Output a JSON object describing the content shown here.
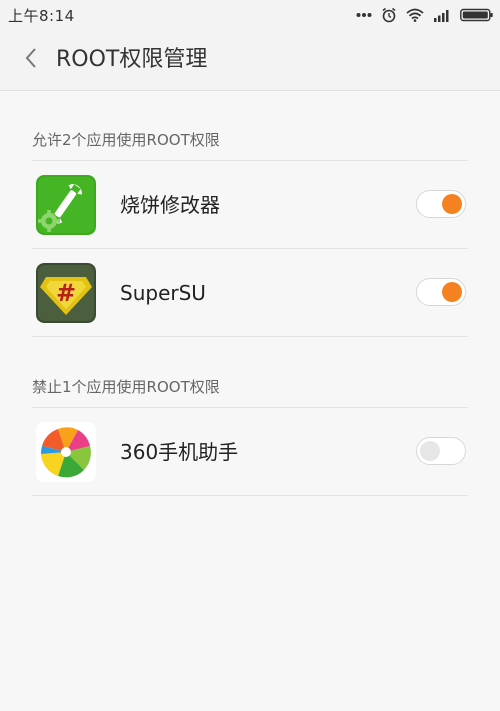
{
  "status_bar": {
    "time": "上午8:14",
    "icons": [
      "more-dots-icon",
      "alarm-icon",
      "wifi-icon",
      "signal-icon",
      "battery-icon"
    ]
  },
  "header": {
    "title": "ROOT权限管理",
    "back_icon": "chevron-left-icon"
  },
  "sections": [
    {
      "title": "允许2个应用使用ROOT权限",
      "apps": [
        {
          "name": "烧饼修改器",
          "icon": "wrench-gear-icon",
          "toggle_on": true
        },
        {
          "name": "SuperSU",
          "icon": "supersu-icon",
          "toggle_on": true
        }
      ]
    },
    {
      "title": "禁止1个应用使用ROOT权限",
      "apps": [
        {
          "name": "360手机助手",
          "icon": "360-assistant-icon",
          "toggle_on": false
        }
      ]
    }
  ],
  "colors": {
    "accent": "#f58220",
    "background": "#f7f7f7",
    "header": "#f3f3f3"
  }
}
